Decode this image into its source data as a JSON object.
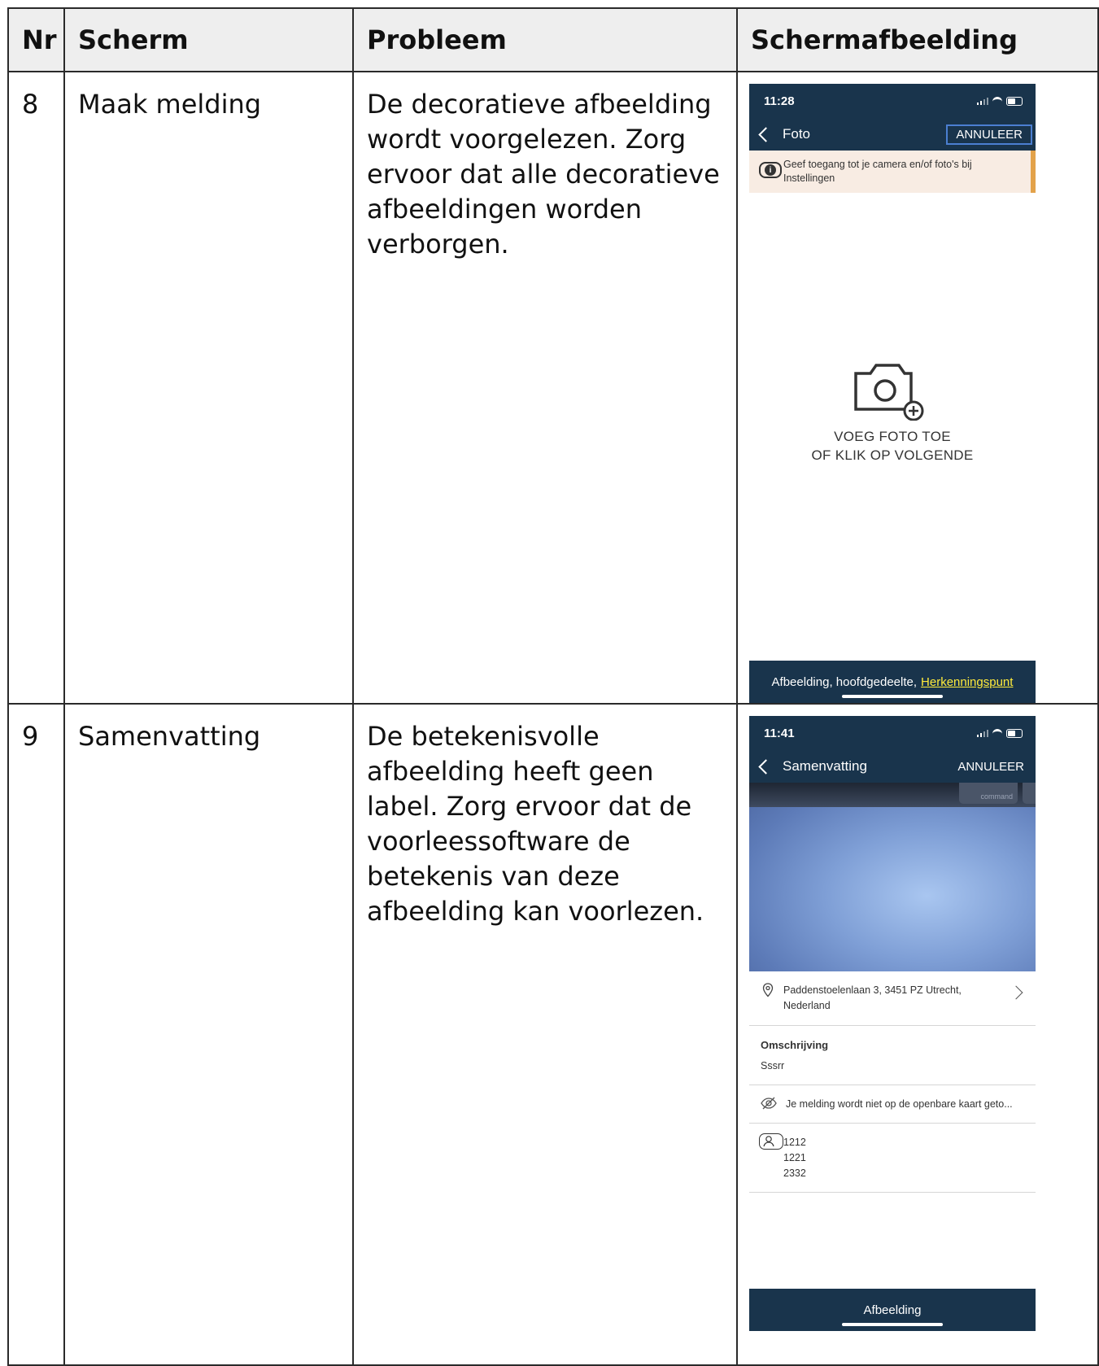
{
  "table": {
    "headers": {
      "nr": "Nr",
      "scherm": "Scherm",
      "probleem": "Probleem",
      "schermafbeelding": "Schermafbeelding"
    },
    "rows": [
      {
        "nr": "8",
        "scherm": "Maak melding",
        "probleem": "De decoratieve afbeelding wordt voorgelezen. Zorg ervoor dat alle decoratieve afbeeldingen worden verborgen.",
        "screenshot": {
          "time": "11:28",
          "nav_title": "Foto",
          "cancel_label": "ANNULEER",
          "notice_text": "Geef toegang tot je camera en/of foto's bij Instellingen",
          "add_photo_line1": "VOEG FOTO TOE",
          "add_photo_line2": "OF KLIK OP VOLGENDE",
          "voiceover_prefix": "Afbeelding, hoofdgedeelte,",
          "voiceover_highlight": "Herkenningspunt",
          "icon": "camera-add-icon"
        }
      },
      {
        "nr": "9",
        "scherm": "Samenvatting",
        "probleem": "De betekenisvolle afbeelding heeft geen label. Zorg ervoor dat de voorleessoftware de betekenis van deze afbeelding kan voorlezen.",
        "screenshot": {
          "time": "11:41",
          "nav_title": "Samenvatting",
          "cancel_label": "ANNULEER",
          "key_label": "command",
          "address_line1": "Paddenstoelenlaan 3, 3451 PZ Utrecht,",
          "address_line2": "Nederland",
          "description_label": "Omschrijving",
          "description_value": "Sssrr",
          "visibility_text": "Je melding wordt niet op de openbare kaart geto...",
          "contact_lines": [
            "1212",
            "1221",
            "2332"
          ],
          "voiceover_text": "Afbeelding"
        }
      }
    ]
  },
  "colors": {
    "nav_bg": "#19344c",
    "header_bg": "#eeeeee",
    "highlight": "#ffeb3b",
    "notice_bg": "#f8ece3",
    "notice_accent": "#e3a24a"
  }
}
